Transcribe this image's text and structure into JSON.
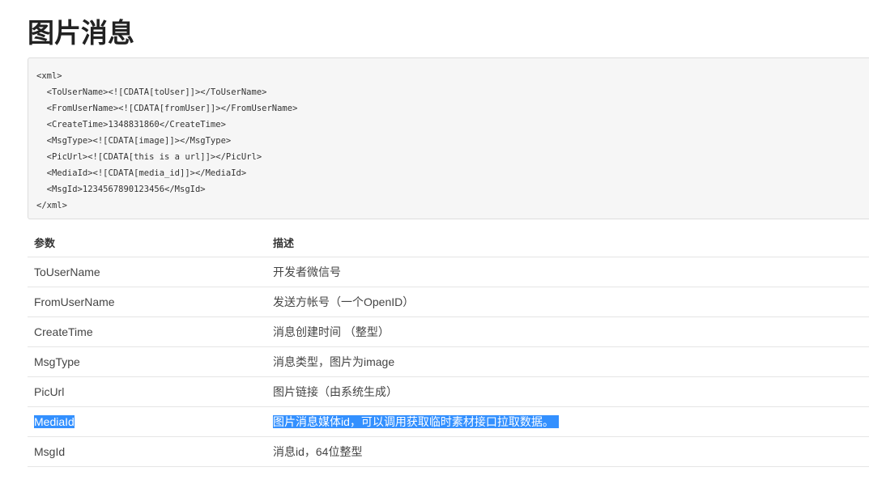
{
  "page": {
    "title": "图片消息"
  },
  "code": {
    "lines": [
      "<xml>",
      "  <ToUserName><![CDATA[toUser]]></ToUserName>",
      "  <FromUserName><![CDATA[fromUser]]></FromUserName>",
      "  <CreateTime>1348831860</CreateTime>",
      "  <MsgType><![CDATA[image]]></MsgType>",
      "  <PicUrl><![CDATA[this is a url]]></PicUrl>",
      "  <MediaId><![CDATA[media_id]]></MediaId>",
      "  <MsgId>1234567890123456</MsgId>",
      "</xml>"
    ]
  },
  "table": {
    "headers": [
      "参数",
      "描述"
    ],
    "rows": [
      {
        "param": "ToUserName",
        "desc": "开发者微信号",
        "selected": false
      },
      {
        "param": "FromUserName",
        "desc": "发送方帐号（一个OpenID）",
        "selected": false
      },
      {
        "param": "CreateTime",
        "desc": "消息创建时间 （整型）",
        "selected": false
      },
      {
        "param": "MsgType",
        "desc": "消息类型，图片为image",
        "selected": false
      },
      {
        "param": "PicUrl",
        "desc": "图片链接（由系统生成）",
        "selected": false
      },
      {
        "param": "MediaId",
        "desc": "图片消息媒体id，可以调用获取临时素材接口拉取数据。",
        "selected": true
      },
      {
        "param": "MsgId",
        "desc": "消息id，64位整型",
        "selected": false
      }
    ]
  },
  "colors": {
    "selection": "#3390ff",
    "code_background": "#f6f6f6",
    "border": "#e5e5e5"
  }
}
